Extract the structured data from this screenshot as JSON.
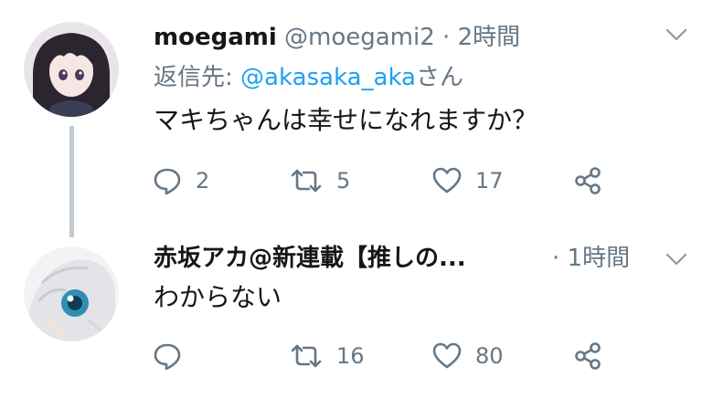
{
  "tweets": [
    {
      "author_name": "moegami",
      "author_handle": "@moegami2",
      "separator": "·",
      "time": "2時間",
      "reply_prefix": "返信先: ",
      "reply_mention": "@akasaka_aka",
      "reply_suffix": "さん",
      "text": "マキちゃんは幸せになれますか？",
      "replies": "2",
      "retweets": "5",
      "likes": "17"
    },
    {
      "author_name": "赤坂アカ@新連載【推しの...",
      "separator": "·",
      "time": "1時間",
      "text": "わからない",
      "replies": "",
      "retweets": "16",
      "likes": "80"
    }
  ],
  "colors": {
    "text": "#14171a",
    "secondary": "#657786",
    "link": "#1da1f2",
    "thread_line": "#c4ccd3"
  }
}
